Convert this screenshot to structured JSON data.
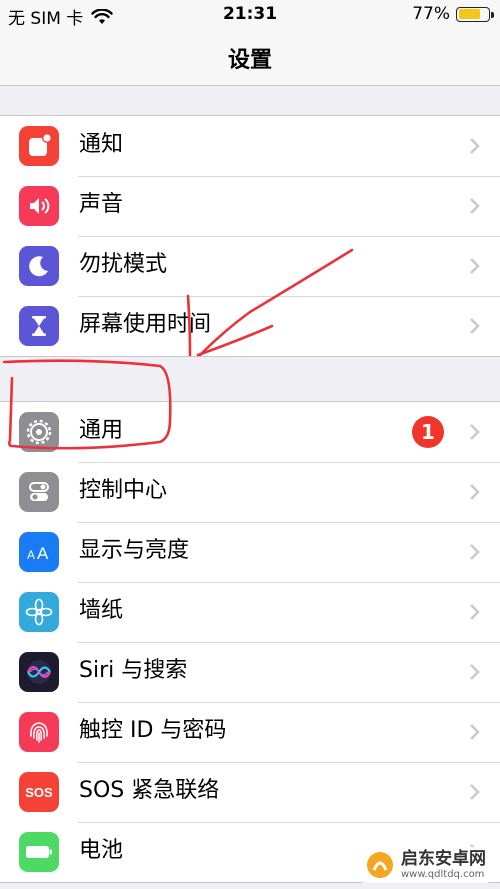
{
  "status_bar": {
    "carrier": "无 SIM 卡",
    "time": "21:31",
    "battery_text": "77%",
    "battery_level": 0.77,
    "wifi_icon": "wifi-icon",
    "battery_color": "#f5c518"
  },
  "nav": {
    "title": "设置"
  },
  "groups": [
    {
      "items": [
        {
          "label": "通知",
          "icon": "notifications-icon",
          "color": "#f44336"
        },
        {
          "label": "声音",
          "icon": "speaker-icon",
          "color": "#f53b57"
        },
        {
          "label": "勿扰模式",
          "icon": "moon-icon",
          "color": "#5b56d6"
        },
        {
          "label": "屏幕使用时间",
          "icon": "hourglass-icon",
          "color": "#5b56d6"
        }
      ]
    },
    {
      "items": [
        {
          "label": "通用",
          "icon": "gear-icon",
          "color": "#8e8e93",
          "badge": "1"
        },
        {
          "label": "控制中心",
          "icon": "toggles-icon",
          "color": "#8e8e93"
        },
        {
          "label": "显示与亮度",
          "icon": "text-size-icon",
          "color": "#1a7cf5"
        },
        {
          "label": "墙纸",
          "icon": "flower-icon",
          "color": "#34aadc"
        },
        {
          "label": "Siri 与搜索",
          "icon": "siri-icon",
          "color": "#1c1c2e"
        },
        {
          "label": "触控 ID 与密码",
          "icon": "fingerprint-icon",
          "color": "#f53b57"
        },
        {
          "label": "SOS 紧急联络",
          "icon": "sos-icon",
          "color": "#f44336",
          "icon_text": "SOS"
        },
        {
          "label": "电池",
          "icon": "battery-icon",
          "color": "#4cd964"
        }
      ]
    }
  ],
  "annotation_color": "#e8323c",
  "watermark": {
    "name": "启东安卓网",
    "url": "www.qdltdq.com"
  }
}
